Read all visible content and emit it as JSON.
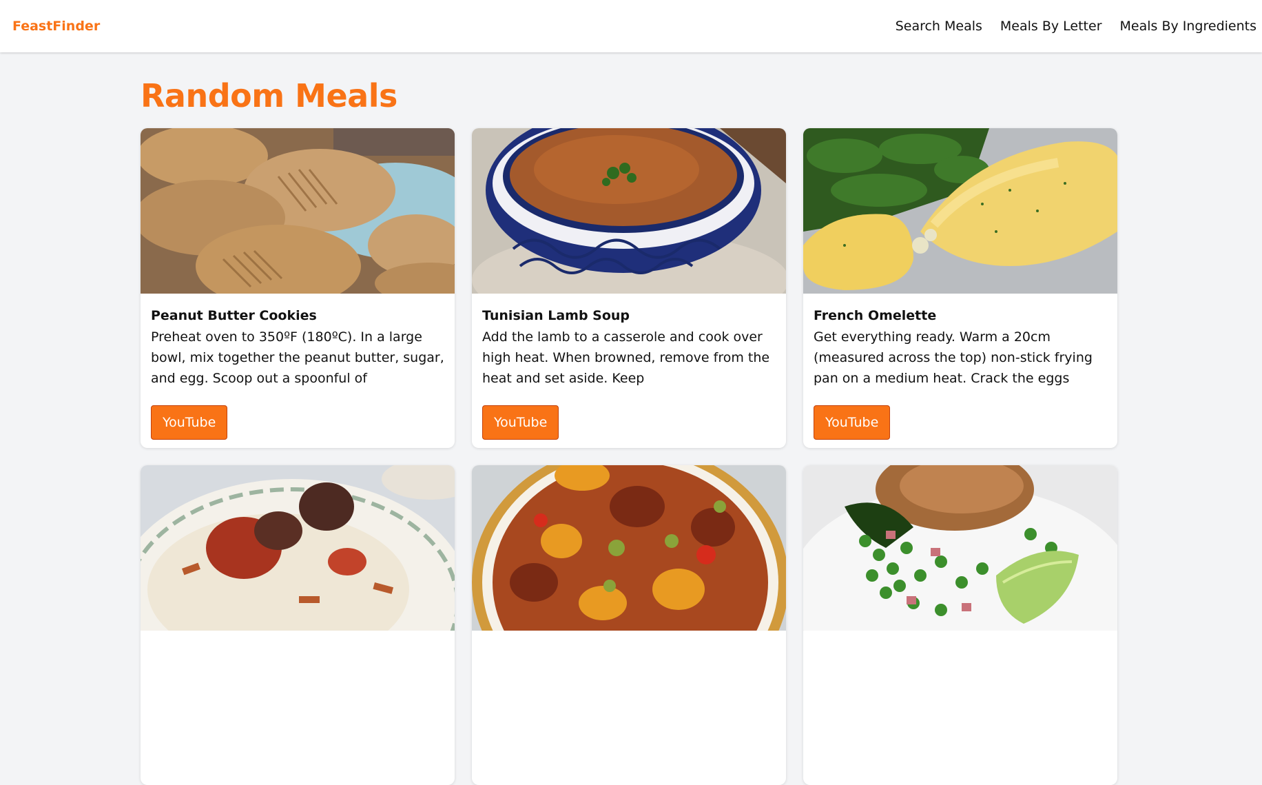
{
  "brand": "FeastFinder",
  "nav": {
    "search": "Search Meals",
    "by_letter": "Meals By Letter",
    "by_ingredients": "Meals By Ingredients"
  },
  "page_title": "Random Meals",
  "colors": {
    "accent": "#f97316",
    "background": "#f3f4f6"
  },
  "meals": [
    {
      "name": "Peanut Butter Cookies",
      "description": "Preheat oven to 350ºF (180ºC). In a large bowl, mix together the peanut butter, sugar, and egg. Scoop out a spoonful of",
      "button": "YouTube",
      "image": "peanut-butter-cookies-photo"
    },
    {
      "name": "Tunisian Lamb Soup",
      "description": "Add the lamb to a casserole and cook over high heat. When browned, remove from the heat and set aside. Keep",
      "button": "YouTube",
      "image": "lamb-soup-photo"
    },
    {
      "name": "French Omelette",
      "description": "Get everything ready. Warm a 20cm (measured across the top) non-stick frying pan on a medium heat. Crack the eggs",
      "button": "YouTube",
      "image": "omelette-photo"
    },
    {
      "name": "",
      "description": "",
      "button": "",
      "image": "rice-beef-photo"
    },
    {
      "name": "",
      "description": "",
      "button": "",
      "image": "stew-photo"
    },
    {
      "name": "",
      "description": "",
      "button": "",
      "image": "duck-peas-photo"
    }
  ]
}
